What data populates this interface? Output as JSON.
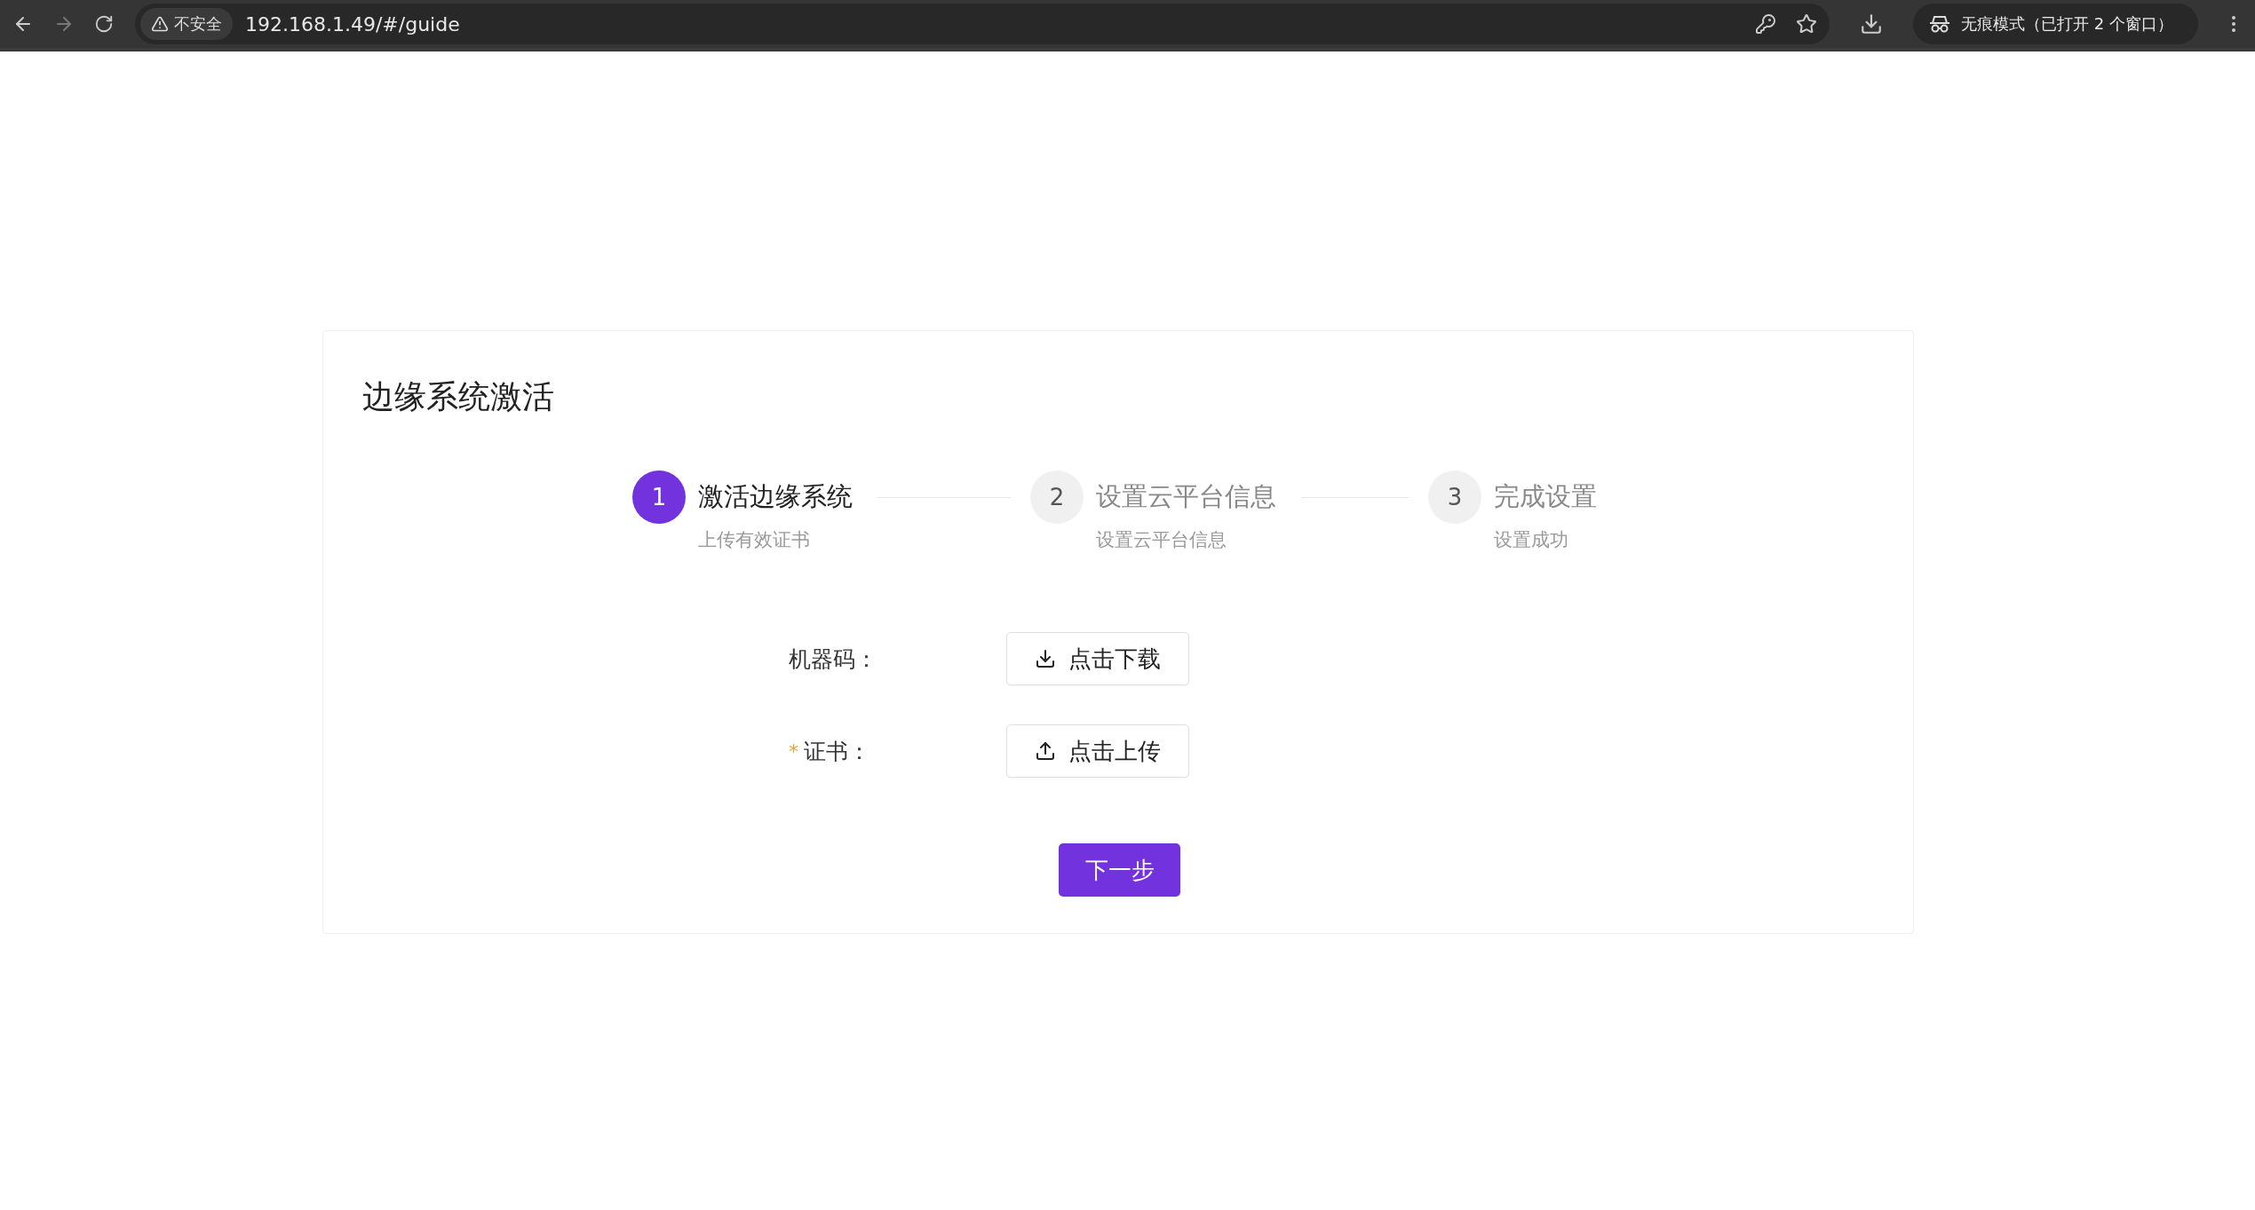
{
  "browser": {
    "security_label": "不安全",
    "url": "192.168.1.49/#/guide",
    "profile_label": "无痕模式（已打开 2 个窗口）"
  },
  "card": {
    "title": "边缘系统激活",
    "steps": [
      {
        "number": "1",
        "title": "激活边缘系统",
        "description": "上传有效证书",
        "selected": true
      },
      {
        "number": "2",
        "title": "设置云平台信息",
        "description": "设置云平台信息",
        "selected": false
      },
      {
        "number": "3",
        "title": "完成设置",
        "description": "设置成功",
        "selected": false
      }
    ],
    "form": [
      {
        "label": "机器码：",
        "kind": "download",
        "button": "点击下载"
      },
      {
        "required_mark": "*",
        "label": "证书：",
        "kind": "upload",
        "button": "点击上传"
      }
    ],
    "submit": "下一步"
  }
}
